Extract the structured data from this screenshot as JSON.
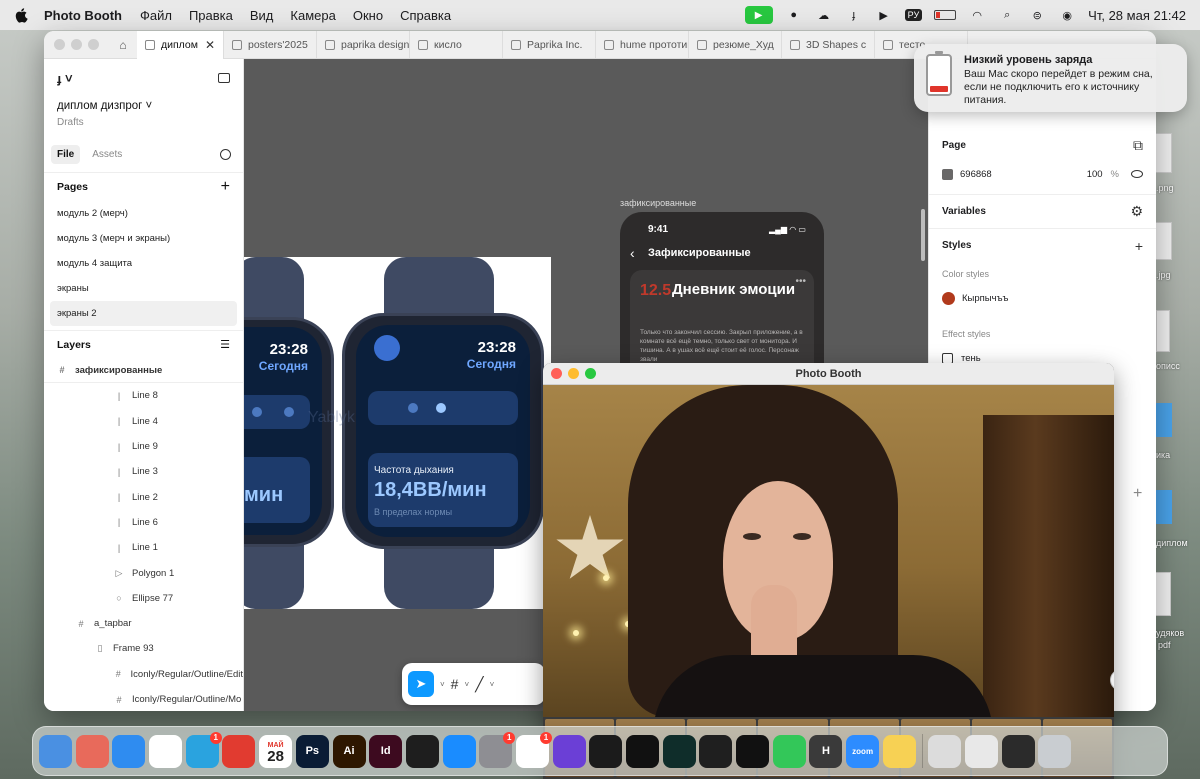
{
  "menubar": {
    "app_name": "Photo Booth",
    "menus": [
      "Файл",
      "Правка",
      "Вид",
      "Камера",
      "Окно",
      "Справка"
    ],
    "input_lang": "РУ",
    "datetime": "Чт, 28 мая  21:42"
  },
  "figma": {
    "tabs": [
      "диплом",
      "posters'2025",
      "paprika design",
      "кисло",
      "Paprika Inc.",
      "hume прототип",
      "резюме_Худ",
      "3D Shapes c",
      "тесто"
    ],
    "file_title": "диплом дизпрог",
    "file_sub": "Drafts",
    "panel_tabs": [
      "File",
      "Assets"
    ],
    "pages_title": "Pages",
    "pages": [
      "модуль 2 (мерч)",
      "модуль 3 (мерч и экраны)",
      "модуль 4 защита",
      "экраны",
      "экраны 2"
    ],
    "layers_title": "Layers",
    "layers": [
      {
        "name": "зафиксированные",
        "icon": "#",
        "indent": 0
      },
      {
        "name": "Line 8",
        "icon": "|",
        "indent": 3
      },
      {
        "name": "Line 4",
        "icon": "|",
        "indent": 3
      },
      {
        "name": "Line 9",
        "icon": "|",
        "indent": 3
      },
      {
        "name": "Line 3",
        "icon": "|",
        "indent": 3
      },
      {
        "name": "Line 2",
        "icon": "|",
        "indent": 3
      },
      {
        "name": "Line 6",
        "icon": "|",
        "indent": 3
      },
      {
        "name": "Line 1",
        "icon": "|",
        "indent": 3
      },
      {
        "name": "Polygon 1",
        "icon": "▷",
        "indent": 3
      },
      {
        "name": "Ellipse 77",
        "icon": "○",
        "indent": 3
      },
      {
        "name": "a_tapbar",
        "icon": "#",
        "indent": 1
      },
      {
        "name": "Frame 93",
        "icon": "▯",
        "indent": 2
      },
      {
        "name": "Iconly/Regular/Outline/Edit",
        "icon": "#",
        "indent": 3
      },
      {
        "name": "Iconly/Regular/Outline/Mo",
        "icon": "#",
        "indent": 3
      }
    ],
    "canvas": {
      "frame_label": "зафиксированные",
      "phone_time": "9:41",
      "phone_header": "Зафиксированные",
      "card_number": "12.5",
      "card_title": "Дневник эмоции",
      "card_body": "Только что закончил сессию. Закрыл приложение, а в комнате всё ещё темно, только свет от монитора. И тишина. А в ушах всё ещё стоит её голос. Персонаж звали",
      "watch_time": "23:28",
      "watch_day": "Сегодня",
      "watch_metric_label": "Частота дыхания",
      "watch_metric_value": "18,4ВВ/мин",
      "watch_metric_value_left": "мин",
      "watch_note": "В пределах нормы",
      "watermark": "Yablyk"
    },
    "right": {
      "page_title": "Page",
      "page_color": "696868",
      "page_opacity": "100",
      "pct": "%",
      "variables": "Variables",
      "styles": "Styles",
      "color_styles": "Color styles",
      "color_style_name": "Кырпычъъ",
      "effect_styles": "Effect styles",
      "effect_style_name": "тень",
      "plus": "+"
    }
  },
  "notification": {
    "title": "Низкий уровень заряда",
    "body": "Ваш Mac скоро перейдет в режим сна, если не подключить его к источнику питания."
  },
  "photobooth": {
    "title": "Photo Booth",
    "help": "?"
  },
  "desktop_files": [
    ".png",
    ".jpg",
    "описс",
    "ика",
    "диплом",
    "удяков",
    "pdf"
  ],
  "dock": {
    "calendar_month": "МАЙ",
    "calendar_day": "28",
    "items": [
      {
        "name": "finder",
        "label": "",
        "color": "#4a90e2"
      },
      {
        "name": "launchpad",
        "label": "",
        "color": "#e86a5b"
      },
      {
        "name": "safari",
        "label": "",
        "color": "#2f8cf0"
      },
      {
        "name": "chrome",
        "label": "",
        "color": "#ffffff"
      },
      {
        "name": "telegram",
        "label": "",
        "color": "#2aa3df",
        "badge": "1"
      },
      {
        "name": "presentation",
        "label": "",
        "color": "#e13b30"
      },
      {
        "name": "calendar",
        "label": "",
        "color": "#ffffff"
      },
      {
        "name": "photoshop",
        "label": "Ps",
        "color": "#0a1c35"
      },
      {
        "name": "illustrator",
        "label": "Ai",
        "color": "#2e1700"
      },
      {
        "name": "indesign",
        "label": "Id",
        "color": "#3d0a1f"
      },
      {
        "name": "figma",
        "label": "",
        "color": "#1e1e1e"
      },
      {
        "name": "app-store",
        "label": "",
        "color": "#1a8cff"
      },
      {
        "name": "system-settings",
        "label": "",
        "color": "#8e8e93",
        "badge": "1"
      },
      {
        "name": "reminders",
        "label": "",
        "color": "#ffffff",
        "badge": "1"
      },
      {
        "name": "star-app",
        "label": "",
        "color": "#6b3fd6"
      },
      {
        "name": "burst-app",
        "label": "",
        "color": "#1b1b1b"
      },
      {
        "name": "spotify",
        "label": "",
        "color": "#111111"
      },
      {
        "name": "vpn-app",
        "label": "",
        "color": "#0f2d2a"
      },
      {
        "name": "chatgpt",
        "label": "",
        "color": "#1f1f1f"
      },
      {
        "name": "capcut",
        "label": "",
        "color": "#111111"
      },
      {
        "name": "messages",
        "label": "",
        "color": "#33c759"
      },
      {
        "name": "h-app",
        "label": "H",
        "color": "#3a3a3a"
      },
      {
        "name": "zoom",
        "label": "zoom",
        "color": "#2d8cff"
      },
      {
        "name": "notes",
        "label": "",
        "color": "#f7d154"
      },
      {
        "name": "stack-1",
        "label": "",
        "color": "#dcdcdc"
      },
      {
        "name": "stack-2",
        "label": "",
        "color": "#e8e8e8"
      },
      {
        "name": "stack-3",
        "label": "",
        "color": "#2b2b2b"
      },
      {
        "name": "trash",
        "label": "",
        "color": "#c9cdd1"
      }
    ]
  }
}
